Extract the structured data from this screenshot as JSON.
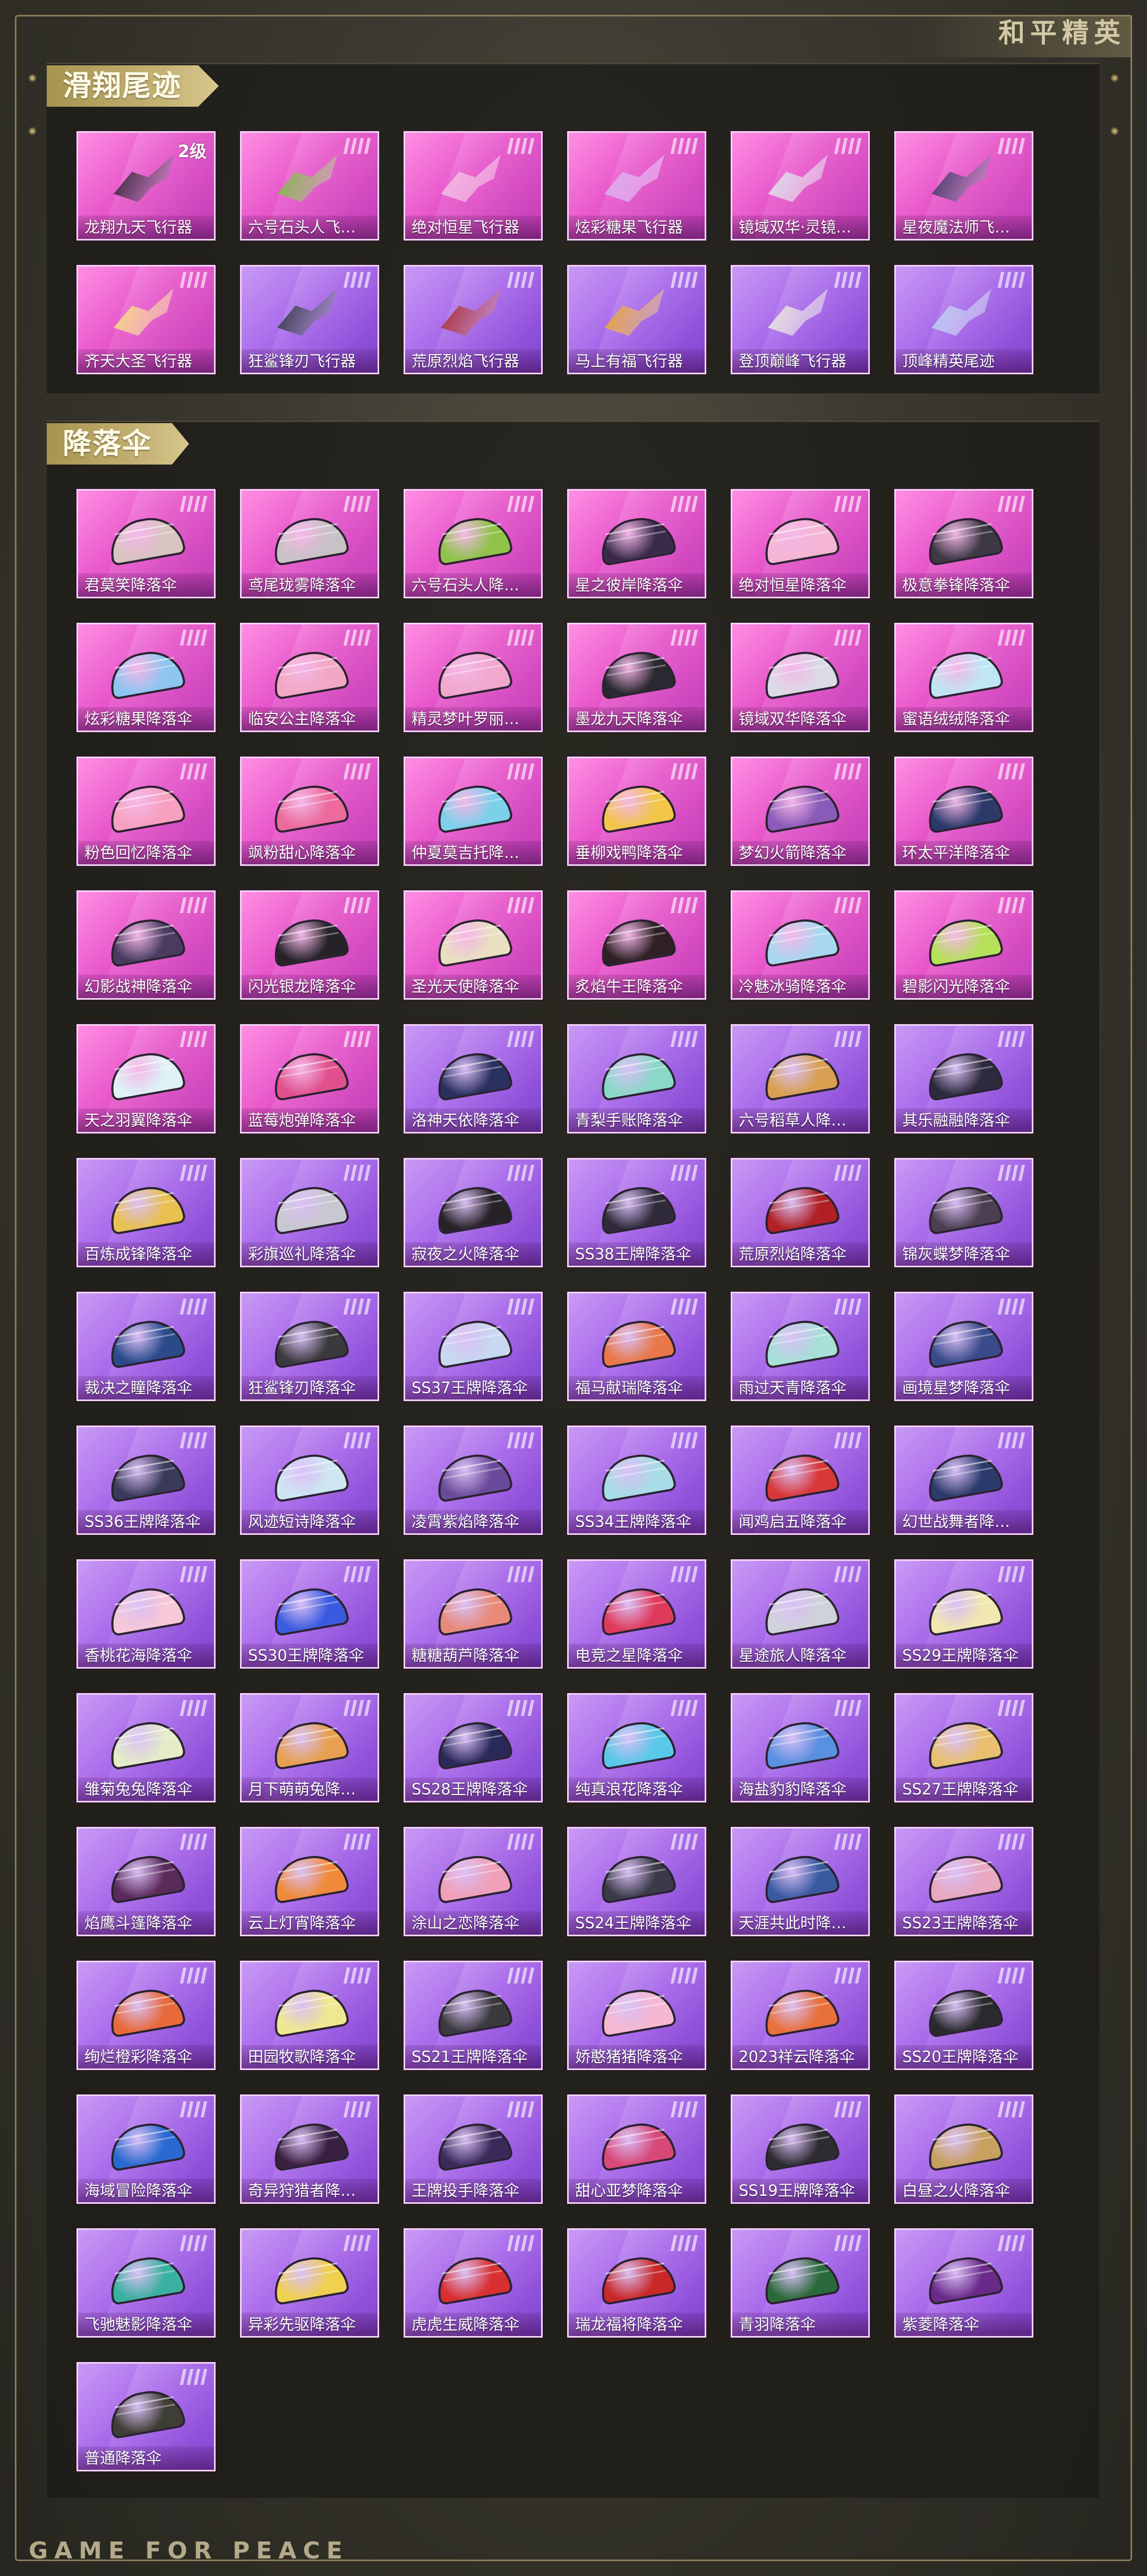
{
  "brand": {
    "title_cn": "和平精英",
    "footer_en": "GAME FOR PEACE"
  },
  "colors": {
    "pink_card": "#e654c9",
    "purple_card": "#a463e8",
    "gold_tag": "#c6b377"
  },
  "sections": [
    {
      "title": "滑翔尾迹",
      "items": [
        {
          "label": "龙翔九天飞行器",
          "level": "2级",
          "theme": "pink",
          "icon": "dragon-glider-icon",
          "color": "#2b1c35"
        },
        {
          "label": "六号石头人飞…",
          "theme": "pink",
          "icon": "plant-glider-icon",
          "color": "#7bb340"
        },
        {
          "label": "绝对恒星飞行器",
          "theme": "pink",
          "icon": "planet-glider-icon",
          "color": "#f0b8e0"
        },
        {
          "label": "炫彩糖果飞行器",
          "theme": "pink",
          "icon": "candy-glider-icon",
          "color": "#d9a8f0"
        },
        {
          "label": "镜域双华·灵镜…",
          "theme": "pink",
          "icon": "mirror-glider-icon",
          "color": "#dcdde8"
        },
        {
          "label": "星夜魔法师飞…",
          "theme": "pink",
          "icon": "wizard-glider-icon",
          "color": "#3a3360"
        },
        {
          "label": "齐天大圣飞行器",
          "theme": "pink",
          "icon": "cloud-glider-icon",
          "color": "#f7d77a"
        },
        {
          "label": "狂鲨锋刃飞行器",
          "theme": "purple",
          "icon": "shark-glider-icon",
          "color": "#2a3040"
        },
        {
          "label": "荒原烈焰飞行器",
          "theme": "purple",
          "icon": "flame-glider-icon",
          "color": "#a8262a"
        },
        {
          "label": "马上有福飞行器",
          "theme": "purple",
          "icon": "horse-glider-icon",
          "color": "#e6a030"
        },
        {
          "label": "登顶巅峰飞行器",
          "theme": "purple",
          "icon": "summit-glider-icon",
          "color": "#e8e4dc"
        },
        {
          "label": "顶峰精英尾迹",
          "theme": "purple",
          "icon": "trail-icon",
          "color": "#b9c8f0"
        }
      ]
    },
    {
      "title": "降落伞",
      "items": [
        {
          "label": "君莫笑降落伞",
          "theme": "pink",
          "icon": "parachute-icon",
          "color": "#d8c4c0"
        },
        {
          "label": "鸢尾珑雾降落伞",
          "theme": "pink",
          "icon": "parachute-icon",
          "color": "#c8c2c6"
        },
        {
          "label": "六号石头人降…",
          "theme": "pink",
          "icon": "parachute-icon",
          "color": "#8fc24a"
        },
        {
          "label": "星之彼岸降落伞",
          "theme": "pink",
          "icon": "parachute-icon",
          "color": "#3a2a4a"
        },
        {
          "label": "绝对恒星降落伞",
          "theme": "pink",
          "icon": "parachute-icon",
          "color": "#f4b6d4"
        },
        {
          "label": "极意拳锋降落伞",
          "theme": "pink",
          "icon": "parachute-icon",
          "color": "#3c3844"
        },
        {
          "label": "炫彩糖果降落伞",
          "theme": "pink",
          "icon": "parachute-icon",
          "color": "#8ec6f0"
        },
        {
          "label": "临安公主降落伞",
          "theme": "pink",
          "icon": "parachute-icon",
          "color": "#f2a8c4"
        },
        {
          "label": "精灵梦叶罗丽…",
          "theme": "pink",
          "icon": "parachute-icon",
          "color": "#f0a8cc"
        },
        {
          "label": "墨龙九天降落伞",
          "theme": "pink",
          "icon": "parachute-icon",
          "color": "#2a2830"
        },
        {
          "label": "镜域双华降落伞",
          "theme": "pink",
          "icon": "parachute-icon",
          "color": "#dcdae6"
        },
        {
          "label": "蜜语绒绒降落伞",
          "theme": "pink",
          "icon": "parachute-icon",
          "color": "#bfe6f2"
        },
        {
          "label": "粉色回忆降落伞",
          "theme": "pink",
          "icon": "parachute-icon",
          "color": "#f7a0c0"
        },
        {
          "label": "飒粉甜心降落伞",
          "theme": "pink",
          "icon": "parachute-icon",
          "color": "#ec6a9c"
        },
        {
          "label": "仲夏莫吉托降…",
          "theme": "pink",
          "icon": "parachute-icon",
          "color": "#7cd0ea"
        },
        {
          "label": "垂柳戏鸭降落伞",
          "theme": "pink",
          "icon": "parachute-icon",
          "color": "#f2c64a"
        },
        {
          "label": "梦幻火箭降落伞",
          "theme": "pink",
          "icon": "parachute-icon",
          "color": "#8a5ab8"
        },
        {
          "label": "环太平洋降落伞",
          "theme": "pink",
          "icon": "parachute-icon",
          "color": "#2c3a6a"
        },
        {
          "label": "幻影战神降落伞",
          "theme": "pink",
          "icon": "parachute-icon",
          "color": "#4a3c60"
        },
        {
          "label": "闪光银龙降落伞",
          "theme": "pink",
          "icon": "parachute-icon",
          "color": "#262228"
        },
        {
          "label": "圣光天使降落伞",
          "theme": "pink",
          "icon": "parachute-icon",
          "color": "#eadfc0"
        },
        {
          "label": "炙焰牛王降落伞",
          "theme": "pink",
          "icon": "parachute-icon",
          "color": "#2e2024"
        },
        {
          "label": "冷魅冰骑降落伞",
          "theme": "pink",
          "icon": "parachute-icon",
          "color": "#a8d8f0"
        },
        {
          "label": "碧影闪光降落伞",
          "theme": "pink",
          "icon": "parachute-icon",
          "color": "#b6e05a"
        },
        {
          "label": "天之羽翼降落伞",
          "theme": "pink",
          "icon": "parachute-icon",
          "color": "#dff2f7"
        },
        {
          "label": "蓝莓炮弹降落伞",
          "theme": "pink",
          "icon": "parachute-icon",
          "color": "#e0508c"
        },
        {
          "label": "洛神天依降落伞",
          "theme": "purple",
          "icon": "parachute-icon",
          "color": "#2a3060"
        },
        {
          "label": "青梨手账降落伞",
          "theme": "purple",
          "icon": "parachute-icon",
          "color": "#8ad8c8"
        },
        {
          "label": "六号稻草人降…",
          "theme": "purple",
          "icon": "parachute-icon",
          "color": "#d8a050"
        },
        {
          "label": "其乐融融降落伞",
          "theme": "purple",
          "icon": "parachute-icon",
          "color": "#2c2a3c"
        },
        {
          "label": "百炼成锋降落伞",
          "theme": "purple",
          "icon": "parachute-icon",
          "color": "#e8c050"
        },
        {
          "label": "彩旗巡礼降落伞",
          "theme": "purple",
          "icon": "parachute-icon",
          "color": "#c8c8d0"
        },
        {
          "label": "寂夜之火降落伞",
          "theme": "purple",
          "icon": "parachute-icon",
          "color": "#262226"
        },
        {
          "label": "SS38王牌降落伞",
          "theme": "purple",
          "icon": "parachute-icon",
          "color": "#2e2a3a"
        },
        {
          "label": "荒原烈焰降落伞",
          "theme": "purple",
          "icon": "parachute-icon",
          "color": "#b02024"
        },
        {
          "label": "锦灰蝶梦降落伞",
          "theme": "purple",
          "icon": "parachute-icon",
          "color": "#4a3e50"
        },
        {
          "label": "裁决之瞳降落伞",
          "theme": "purple",
          "icon": "parachute-icon",
          "color": "#2a4a8a"
        },
        {
          "label": "狂鲨锋刃降落伞",
          "theme": "purple",
          "icon": "parachute-icon",
          "color": "#3a3a3e"
        },
        {
          "label": "SS37王牌降落伞",
          "theme": "purple",
          "icon": "parachute-icon",
          "color": "#c8d8f0"
        },
        {
          "label": "福马献瑞降落伞",
          "theme": "purple",
          "icon": "parachute-icon",
          "color": "#e8784a"
        },
        {
          "label": "雨过天青降落伞",
          "theme": "purple",
          "icon": "parachute-icon",
          "color": "#a8e0d8"
        },
        {
          "label": "画境星梦降落伞",
          "theme": "purple",
          "icon": "parachute-icon",
          "color": "#3a4a8a"
        },
        {
          "label": "SS36王牌降落伞",
          "theme": "purple",
          "icon": "parachute-icon",
          "color": "#3a3a5a"
        },
        {
          "label": "风迹短诗降落伞",
          "theme": "purple",
          "icon": "parachute-icon",
          "color": "#cfe6f2"
        },
        {
          "label": "凌霄紫焰降落伞",
          "theme": "purple",
          "icon": "parachute-icon",
          "color": "#6a4a9a"
        },
        {
          "label": "SS34王牌降落伞",
          "theme": "purple",
          "icon": "parachute-icon",
          "color": "#a8dce6"
        },
        {
          "label": "闻鸡启五降落伞",
          "theme": "purple",
          "icon": "parachute-icon",
          "color": "#d83838"
        },
        {
          "label": "幻世战舞者降…",
          "theme": "purple",
          "icon": "parachute-icon",
          "color": "#2a3a6a"
        },
        {
          "label": "香桃花海降落伞",
          "theme": "purple",
          "icon": "parachute-icon",
          "color": "#f6c8d8"
        },
        {
          "label": "SS30王牌降落伞",
          "theme": "purple",
          "icon": "parachute-icon",
          "color": "#3a5ae0"
        },
        {
          "label": "糖糖葫芦降落伞",
          "theme": "purple",
          "icon": "parachute-icon",
          "color": "#e88a7a"
        },
        {
          "label": "电竞之星降落伞",
          "theme": "purple",
          "icon": "parachute-icon",
          "color": "#e03a5a"
        },
        {
          "label": "星途旅人降落伞",
          "theme": "purple",
          "icon": "parachute-icon",
          "color": "#d0d2da"
        },
        {
          "label": "SS29王牌降落伞",
          "theme": "purple",
          "icon": "parachute-icon",
          "color": "#f0e8b0"
        },
        {
          "label": "雏菊兔兔降落伞",
          "theme": "purple",
          "icon": "parachute-icon",
          "color": "#e4ecc8"
        },
        {
          "label": "月下萌萌兔降…",
          "theme": "purple",
          "icon": "parachute-icon",
          "color": "#e8a050"
        },
        {
          "label": "SS28王牌降落伞",
          "theme": "purple",
          "icon": "parachute-icon",
          "color": "#2a2a5a"
        },
        {
          "label": "纯真浪花降落伞",
          "theme": "purple",
          "icon": "parachute-icon",
          "color": "#5ac8e8"
        },
        {
          "label": "海盐豹豹降落伞",
          "theme": "purple",
          "icon": "parachute-icon",
          "color": "#5a90e0"
        },
        {
          "label": "SS27王牌降落伞",
          "theme": "purple",
          "icon": "parachute-icon",
          "color": "#e8c070"
        },
        {
          "label": "焰鹰斗篷降落伞",
          "theme": "purple",
          "icon": "parachute-icon",
          "color": "#5a2a5a"
        },
        {
          "label": "云上灯宵降落伞",
          "theme": "purple",
          "icon": "parachute-icon",
          "color": "#f08a3a"
        },
        {
          "label": "涂山之恋降落伞",
          "theme": "purple",
          "icon": "parachute-icon",
          "color": "#f0a0b8"
        },
        {
          "label": "SS24王牌降落伞",
          "theme": "purple",
          "icon": "parachute-icon",
          "color": "#3a3a48"
        },
        {
          "label": "天涯共此时降…",
          "theme": "purple",
          "icon": "parachute-icon",
          "color": "#3a5aa0"
        },
        {
          "label": "SS23王牌降落伞",
          "theme": "purple",
          "icon": "parachute-icon",
          "color": "#e8a8c0"
        },
        {
          "label": "绚烂橙彩降落伞",
          "theme": "purple",
          "icon": "parachute-icon",
          "color": "#e86a3a"
        },
        {
          "label": "田园牧歌降落伞",
          "theme": "purple",
          "icon": "parachute-icon",
          "color": "#f0e890"
        },
        {
          "label": "SS21王牌降落伞",
          "theme": "purple",
          "icon": "parachute-icon",
          "color": "#3a3a3e"
        },
        {
          "label": "娇憨猪猪降落伞",
          "theme": "purple",
          "icon": "parachute-icon",
          "color": "#f6b8d0"
        },
        {
          "label": "2023祥云降落伞",
          "theme": "purple",
          "icon": "parachute-icon",
          "color": "#e8703a"
        },
        {
          "label": "SS20王牌降落伞",
          "theme": "purple",
          "icon": "parachute-icon",
          "color": "#2a2a2e"
        },
        {
          "label": "海域冒险降落伞",
          "theme": "purple",
          "icon": "parachute-icon",
          "color": "#2a6ad0"
        },
        {
          "label": "奇异狩猎者降…",
          "theme": "purple",
          "icon": "parachute-icon",
          "color": "#3a2040"
        },
        {
          "label": "王牌投手降落伞",
          "theme": "purple",
          "icon": "parachute-icon",
          "color": "#3a2a5a"
        },
        {
          "label": "甜心亚梦降落伞",
          "theme": "purple",
          "icon": "parachute-icon",
          "color": "#d84878"
        },
        {
          "label": "SS19王牌降落伞",
          "theme": "purple",
          "icon": "parachute-icon",
          "color": "#2e2c30"
        },
        {
          "label": "白昼之火降落伞",
          "theme": "purple",
          "icon": "parachute-icon",
          "color": "#c8a060"
        },
        {
          "label": "飞驰魅影降落伞",
          "theme": "purple",
          "icon": "parachute-icon",
          "color": "#3ab0a0"
        },
        {
          "label": "异彩先驱降落伞",
          "theme": "purple",
          "icon": "parachute-icon",
          "color": "#f0d050"
        },
        {
          "label": "虎虎生威降落伞",
          "theme": "purple",
          "icon": "parachute-icon",
          "color": "#d83030"
        },
        {
          "label": "瑞龙福将降落伞",
          "theme": "purple",
          "icon": "parachute-icon",
          "color": "#c82828"
        },
        {
          "label": "青羽降落伞",
          "theme": "purple",
          "icon": "parachute-icon",
          "color": "#2a6a3a"
        },
        {
          "label": "紫菱降落伞",
          "theme": "purple",
          "icon": "parachute-icon",
          "color": "#6a2a8a"
        },
        {
          "label": "普通降落伞",
          "theme": "purple",
          "icon": "parachute-icon",
          "color": "#3e3e36"
        }
      ]
    }
  ]
}
